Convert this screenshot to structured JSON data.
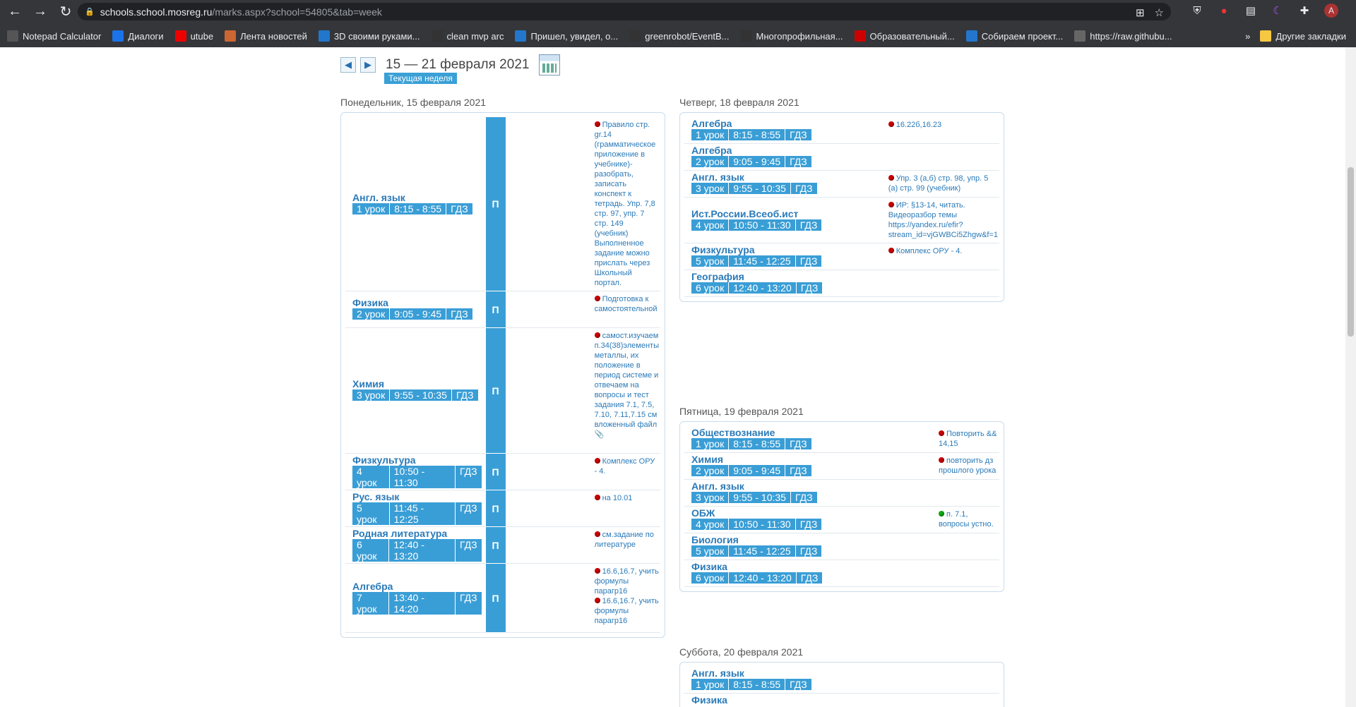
{
  "browser": {
    "url_host": "schools.school.mosreg.ru",
    "url_path": "/marks.aspx?school=54805&tab=week",
    "avatar": "A",
    "bookmarks": [
      "Notepad Calculator",
      "Диалоги",
      "utube",
      "Лента новостей",
      "3D своими руками...",
      "clean mvp arc",
      "Пришел, увидел, о...",
      "greenrobot/EventB...",
      "Многопрофильная...",
      "Образовательный...",
      "Собираем проект...",
      "https://raw.githubu..."
    ],
    "other_bookmarks": "Другие закладки"
  },
  "week": {
    "title": "15 — 21 февраля 2021",
    "current": "Текущая неделя"
  },
  "monday": {
    "title": "Понедельник, 15 февраля 2021",
    "lessons": [
      {
        "name": "Англ. язык",
        "num": "1 урок",
        "time": "8:15 - 8:55",
        "gdz": "ГДЗ",
        "mark": "П",
        "hw": [
          "Правило стр. gr.14 (грамматическое приложение в учебнике)-разобрать, записать конспект к тетрадь. Упр. 7,8 стр. 97, упр. 7 стр. 149 (учебник) Выполненное задание можно прислать через Школьный портал."
        ]
      },
      {
        "name": "Физика",
        "num": "2 урок",
        "time": "9:05 - 9:45",
        "gdz": "ГДЗ",
        "mark": "П",
        "hw": [
          "Подготовка к самостоятельной"
        ]
      },
      {
        "name": "Химия",
        "num": "3 урок",
        "time": "9:55 - 10:35",
        "gdz": "ГДЗ",
        "mark": "П",
        "hw": [
          "самост.изучаем п.34(38)элементы металлы, их положение в период системе и отвечаем на вопросы и тест задания 7.1, 7.5, 7.10, 7.11,7.15 см вложенный файл 📎"
        ]
      },
      {
        "name": "Физкультура",
        "num": "4 урок",
        "time": "10:50 - 11:30",
        "gdz": "ГДЗ",
        "mark": "П",
        "hw": [
          "Комплекс ОРУ - 4."
        ]
      },
      {
        "name": "Рус. язык",
        "num": "5 урок",
        "time": "11:45 - 12:25",
        "gdz": "ГДЗ",
        "mark": "П",
        "hw": [
          "на 10.01"
        ]
      },
      {
        "name": "Родная литература",
        "num": "6 урок",
        "time": "12:40 - 13:20",
        "gdz": "ГДЗ",
        "mark": "П",
        "hw": [
          "см.задание по литературе"
        ]
      },
      {
        "name": "Алгебра",
        "num": "7 урок",
        "time": "13:40 - 14:20",
        "gdz": "ГДЗ",
        "mark": "П",
        "hw": [
          "16.6,16.7, учить формулы парагр16",
          "16.6,16.7, учить формулы парагр16"
        ]
      }
    ]
  },
  "thursday": {
    "title": "Четверг, 18 февраля 2021",
    "lessons": [
      {
        "name": "Алгебра",
        "num": "1 урок",
        "time": "8:15 - 8:55",
        "gdz": "ГДЗ",
        "hw": [
          "16.22б,16.23"
        ]
      },
      {
        "name": "Алгебра",
        "num": "2 урок",
        "time": "9:05 - 9:45",
        "gdz": "ГДЗ",
        "hw": []
      },
      {
        "name": "Англ. язык",
        "num": "3 урок",
        "time": "9:55 - 10:35",
        "gdz": "ГДЗ",
        "hw": [
          "Упр. 3 (а,б) стр. 98, упр. 5 (а) стр. 99 (учебник)"
        ]
      },
      {
        "name": "Ист.России.Всеоб.ист",
        "num": "4 урок",
        "time": "10:50 - 11:30",
        "gdz": "ГДЗ",
        "hw": [
          "ИР: §13-14, читать. Видеоразбор темы https://yandex.ru/efir?stream_id=vjGWBCi5Zhgw&f=1"
        ]
      },
      {
        "name": "Физкультура",
        "num": "5 урок",
        "time": "11:45 - 12:25",
        "gdz": "ГДЗ",
        "hw": [
          "Комплекс ОРУ - 4."
        ]
      },
      {
        "name": "География",
        "num": "6 урок",
        "time": "12:40 - 13:20",
        "gdz": "ГДЗ",
        "hw": []
      }
    ]
  },
  "friday": {
    "title": "Пятница, 19 февраля 2021",
    "lessons": [
      {
        "name": "Обществознание",
        "num": "1 урок",
        "time": "8:15 - 8:55",
        "gdz": "ГДЗ",
        "hw": [
          "Повторить && 14,15"
        ]
      },
      {
        "name": "Химия",
        "num": "2 урок",
        "time": "9:05 - 9:45",
        "gdz": "ГДЗ",
        "hw": [
          "повторить дз прошлого урока"
        ]
      },
      {
        "name": "Англ. язык",
        "num": "3 урок",
        "time": "9:55 - 10:35",
        "gdz": "ГДЗ",
        "hw": []
      },
      {
        "name": "ОБЖ",
        "num": "4 урок",
        "time": "10:50 - 11:30",
        "gdz": "ГДЗ",
        "hw": [
          "п. 7.1, вопросы устно."
        ],
        "green": true
      },
      {
        "name": "Биология",
        "num": "5 урок",
        "time": "11:45 - 12:25",
        "gdz": "ГДЗ",
        "hw": []
      },
      {
        "name": "Физика",
        "num": "6 урок",
        "time": "12:40 - 13:20",
        "gdz": "ГДЗ",
        "hw": []
      }
    ]
  },
  "saturday": {
    "title": "Суббота, 20 февраля 2021",
    "lessons": [
      {
        "name": "Англ. язык",
        "num": "1 урок",
        "time": "8:15 - 8:55",
        "gdz": "ГДЗ",
        "hw": []
      },
      {
        "name": "Физика",
        "num": "",
        "time": "",
        "gdz": "",
        "hw": []
      }
    ]
  }
}
